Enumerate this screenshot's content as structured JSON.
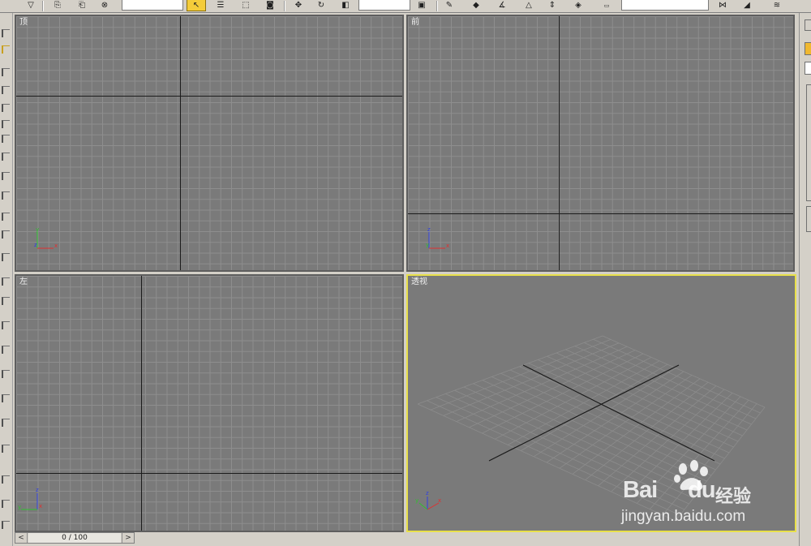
{
  "viewports": {
    "top": {
      "label": "顶"
    },
    "front": {
      "label": "前"
    },
    "left": {
      "label": "左"
    },
    "perspective": {
      "label": "透视"
    }
  },
  "gizmo_labels": {
    "x": "x",
    "y": "y",
    "z": "z"
  },
  "time_slider": {
    "prev": "<",
    "display": "0 / 100",
    "next": ">"
  },
  "watermark": {
    "brand": "Bai",
    "brand_suffix": "du",
    "cn": "经验",
    "url": "jingyan.baidu.com"
  },
  "colors": {
    "viewport_bg": "#7a7a7a",
    "grid_line": "#8e8e8e",
    "active_border": "#e8e04a",
    "axis_x": "#e03030",
    "axis_y": "#30c030",
    "axis_z": "#3040e0"
  }
}
